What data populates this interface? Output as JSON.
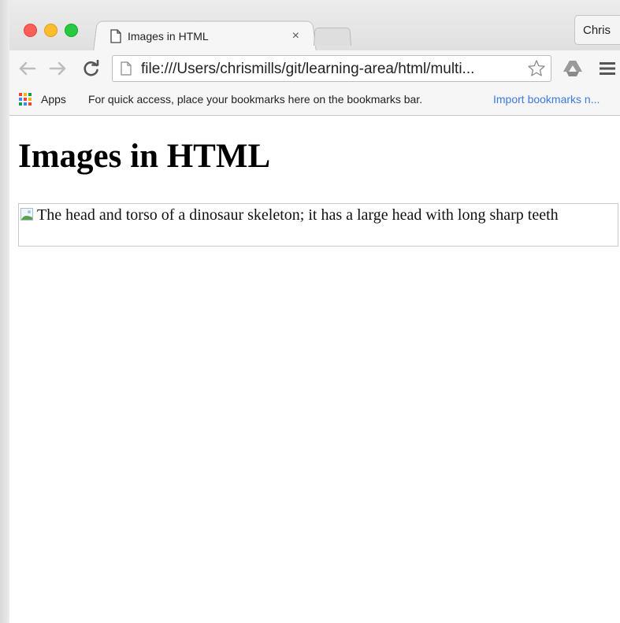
{
  "browser": {
    "tab": {
      "title": "Images in HTML",
      "close_glyph": "×"
    },
    "profile_label": "Chris",
    "address_bar": {
      "url": "file:///Users/chrismills/git/learning-area/html/multi..."
    },
    "bookmarks_bar": {
      "apps_label": "Apps",
      "hint": "For quick access, place your bookmarks here on the bookmarks bar.",
      "import_link": "Import bookmarks n..."
    },
    "icons": {
      "back": "back-arrow-icon",
      "forward": "forward-arrow-icon",
      "reload": "reload-icon",
      "bookmark_star": "star-icon",
      "extension": "google-drive-icon",
      "menu": "hamburger-menu-icon",
      "apps": "apps-grid-icon",
      "page": "page-icon"
    },
    "colors": {
      "close": "#fc5f57",
      "minimize": "#fdbc2e",
      "maximize": "#28c940",
      "link": "#3b78e7"
    }
  },
  "page": {
    "heading": "Images in HTML",
    "image_alt": "The head and torso of a dinosaur skeleton; it has a large head with long sharp teeth"
  }
}
